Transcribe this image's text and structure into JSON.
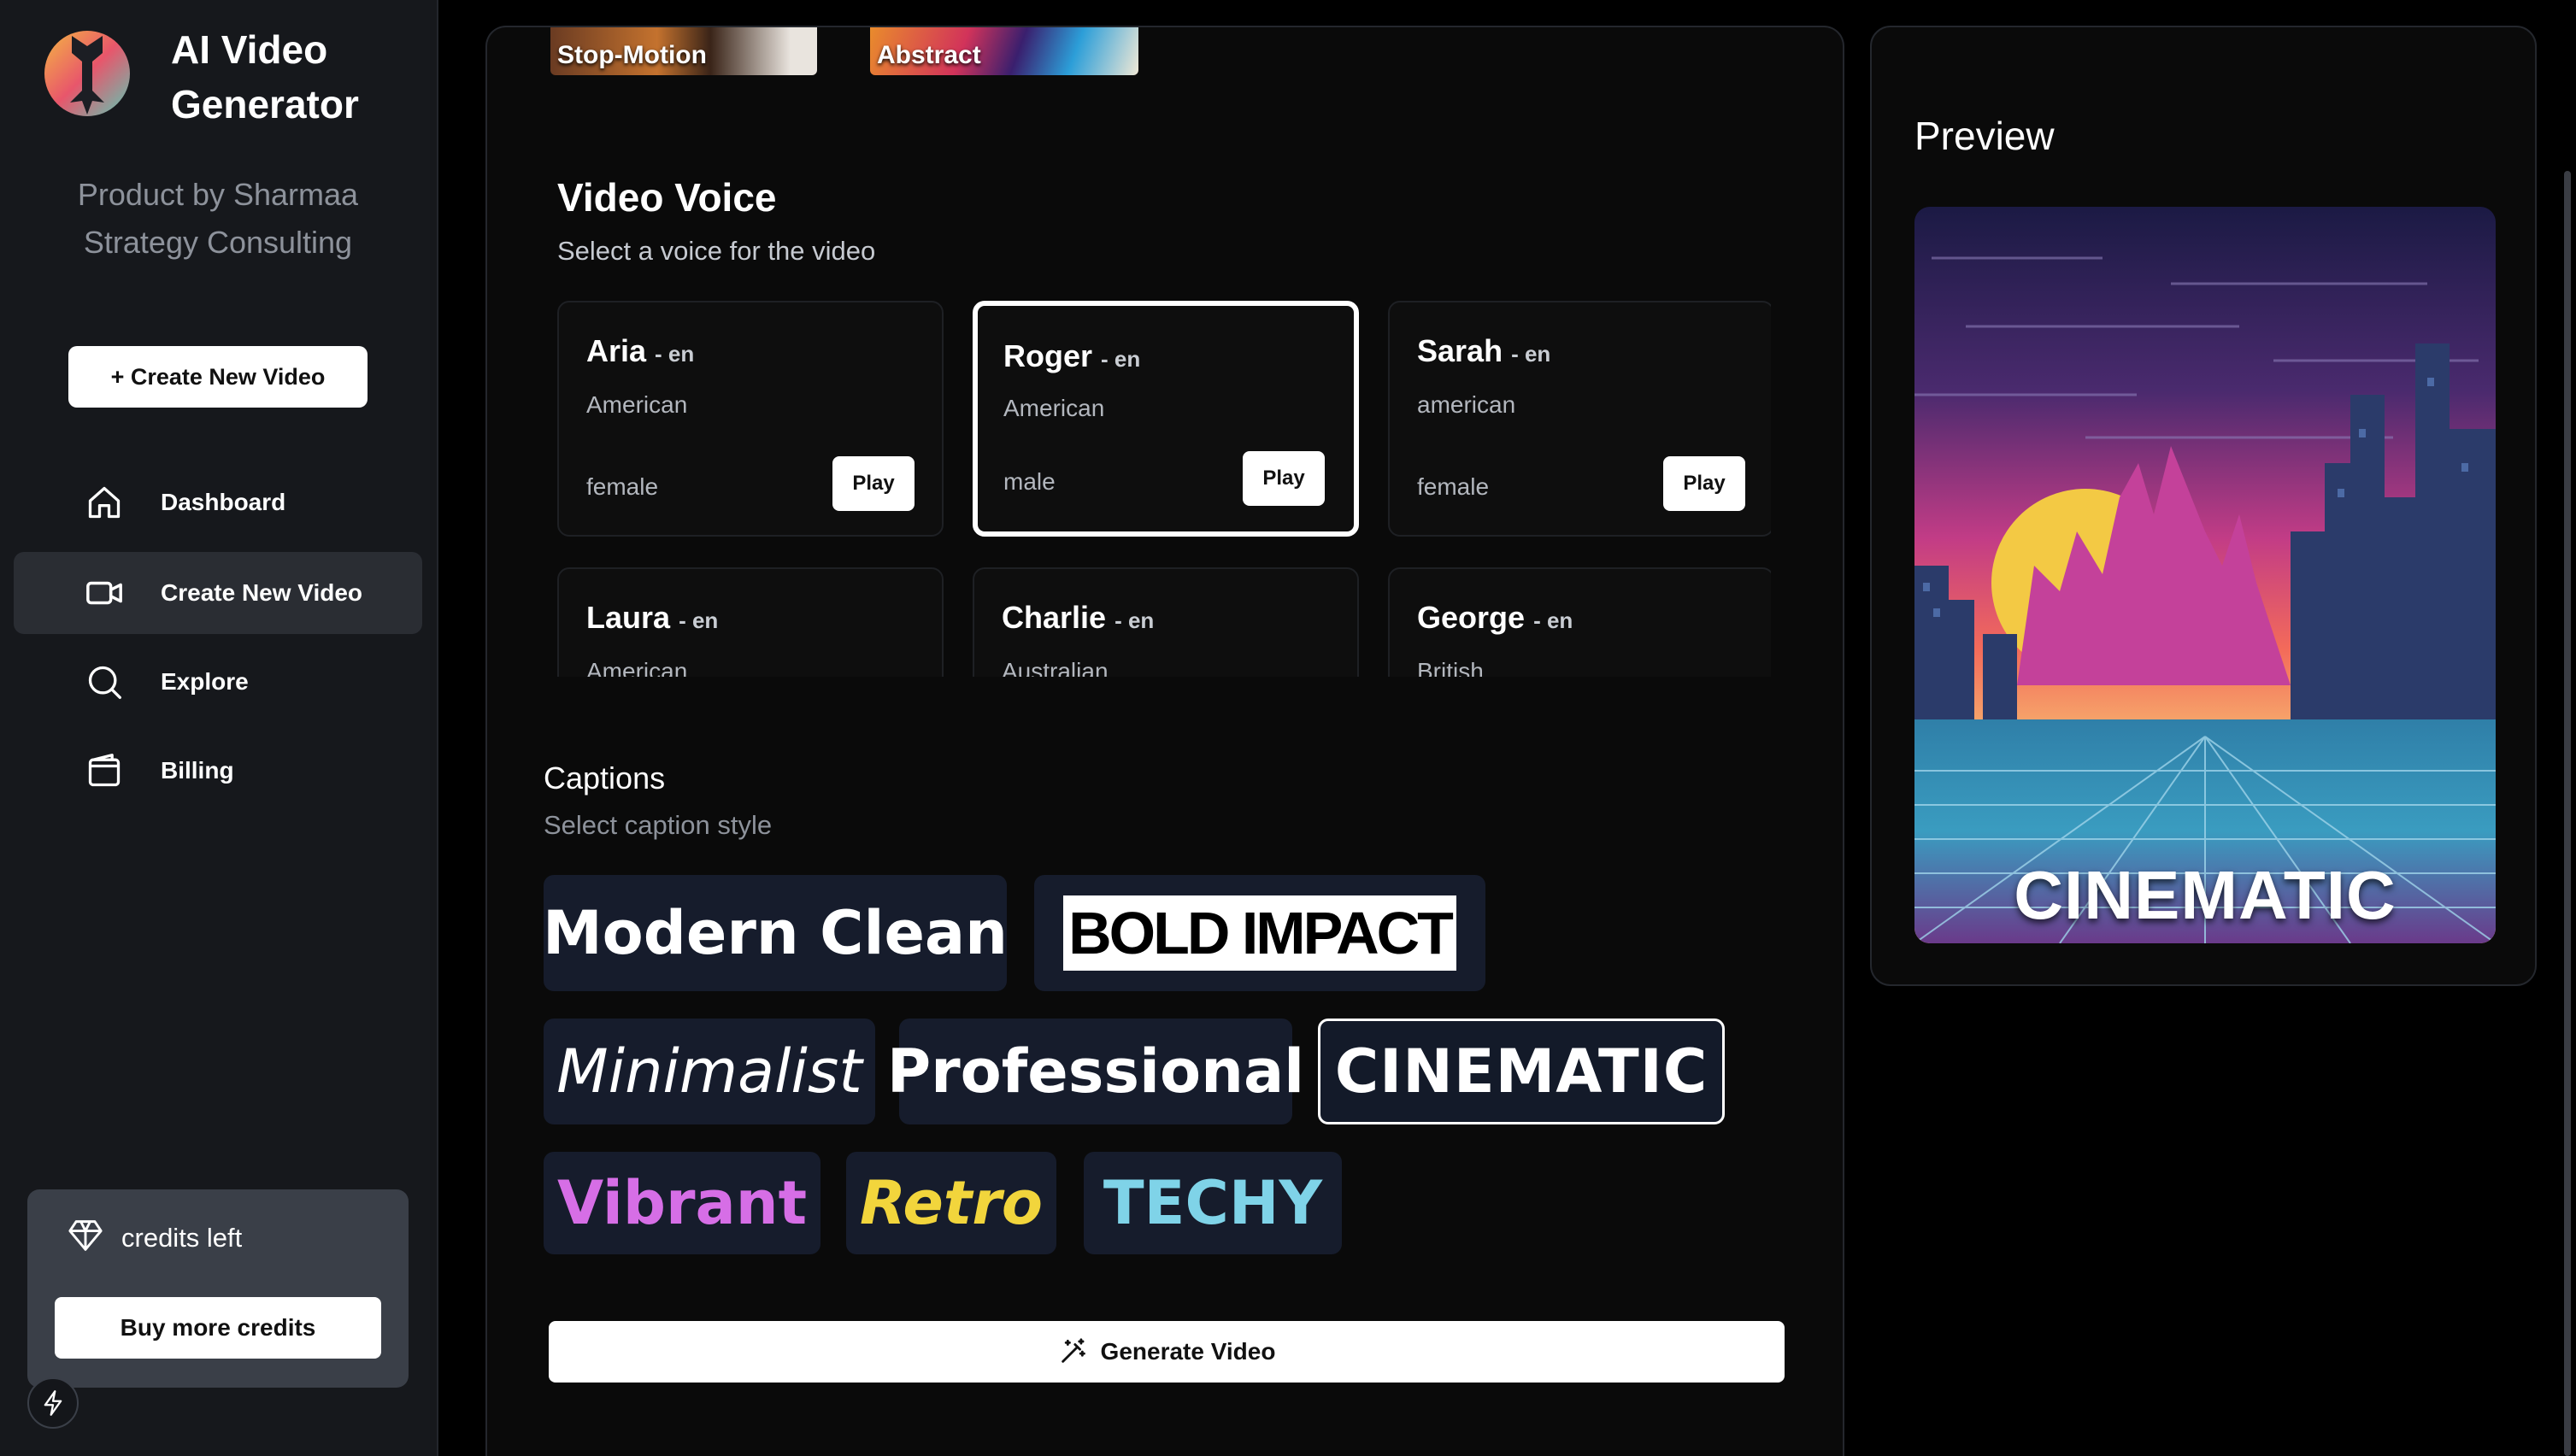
{
  "app": {
    "title_line1": "AI Video",
    "title_line2": "Generator",
    "byline_line1": "Product by Sharmaa",
    "byline_line2": "Strategy Consulting"
  },
  "sidebar": {
    "create_button": "+ Create New Video",
    "items": [
      {
        "label": "Dashboard",
        "icon": "home-icon"
      },
      {
        "label": "Create New Video",
        "icon": "video-camera-icon",
        "active": true
      },
      {
        "label": "Explore",
        "icon": "search-icon"
      },
      {
        "label": "Billing",
        "icon": "wallet-icon"
      }
    ],
    "credits_label": "credits left",
    "buy_button": "Buy more credits"
  },
  "styles": [
    {
      "label": "Stop-Motion"
    },
    {
      "label": "Abstract"
    }
  ],
  "voice_section": {
    "title": "Video Voice",
    "subtitle": "Select a voice for the video",
    "voices": [
      {
        "name": "Aria",
        "lang": "- en",
        "accent": "American",
        "gender": "female",
        "play": "Play"
      },
      {
        "name": "Roger",
        "lang": "- en",
        "accent": "American",
        "gender": "male",
        "play": "Play",
        "selected": true
      },
      {
        "name": "Sarah",
        "lang": "- en",
        "accent": "american",
        "gender": "female",
        "play": "Play"
      },
      {
        "name": "Laura",
        "lang": "- en",
        "accent": "American"
      },
      {
        "name": "Charlie",
        "lang": "- en",
        "accent": "Australian"
      },
      {
        "name": "George",
        "lang": "- en",
        "accent": "British"
      }
    ]
  },
  "captions": {
    "title": "Captions",
    "subtitle": "Select caption style",
    "options": [
      "Modern Clean",
      "BOLD IMPACT",
      "Minimalist",
      "Professional",
      "CINEMATIC",
      "Vibrant",
      "Retro",
      "TECHY"
    ],
    "selected": "CINEMATIC"
  },
  "generate_button": "Generate Video",
  "preview": {
    "title": "Preview",
    "caption": "CINEMATIC"
  },
  "colors": {
    "sidebar_bg": "#16181c",
    "active_nav": "#2a2d33",
    "caption_chip_bg": "#161c2c",
    "vibrant": "#d66ee6",
    "retro": "#f2d53c",
    "techy": "#7fd3e8"
  }
}
